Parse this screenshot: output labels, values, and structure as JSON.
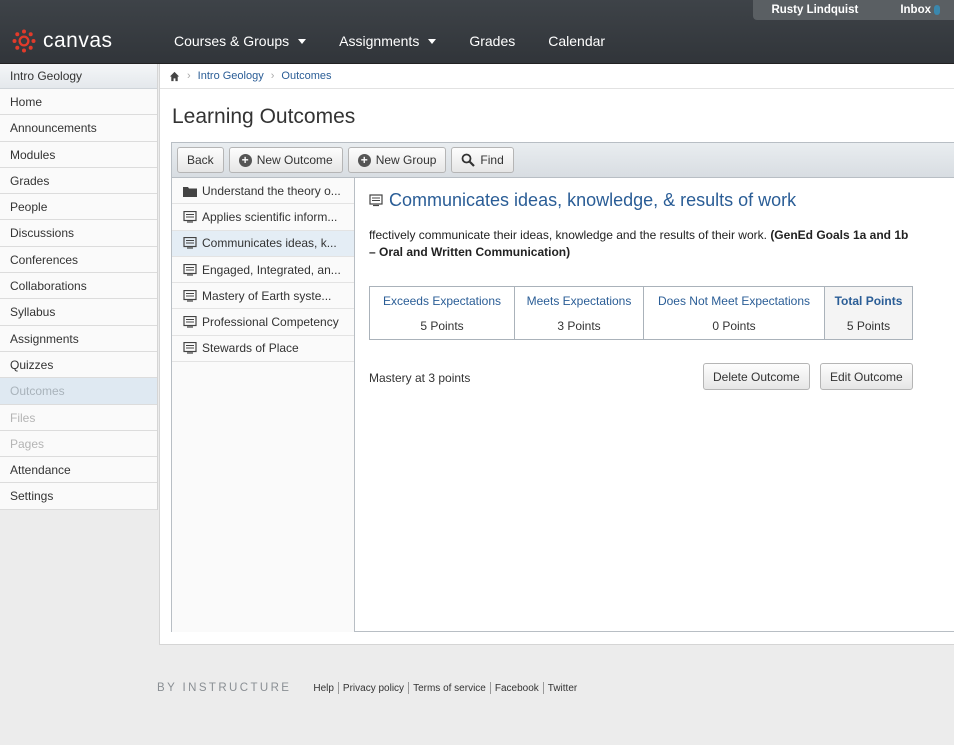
{
  "header": {
    "logo_text": "canvas",
    "user_name": "Rusty Lindquist",
    "inbox_label": "Inbox",
    "nav": [
      {
        "label": "Courses & Groups",
        "has_menu": true
      },
      {
        "label": "Assignments",
        "has_menu": true
      },
      {
        "label": "Grades",
        "has_menu": false
      },
      {
        "label": "Calendar",
        "has_menu": false
      }
    ]
  },
  "course_nav": {
    "title": "Intro Geology",
    "items": [
      {
        "label": "Home"
      },
      {
        "label": "Announcements"
      },
      {
        "label": "Modules"
      },
      {
        "label": "Grades"
      },
      {
        "label": "People"
      },
      {
        "label": "Discussions"
      },
      {
        "label": "Conferences"
      },
      {
        "label": "Collaborations"
      },
      {
        "label": "Syllabus"
      },
      {
        "label": "Assignments"
      },
      {
        "label": "Quizzes"
      },
      {
        "label": "Outcomes",
        "state": "active"
      },
      {
        "label": "Files",
        "state": "disabled"
      },
      {
        "label": "Pages",
        "state": "disabled"
      },
      {
        "label": "Attendance"
      },
      {
        "label": "Settings"
      }
    ]
  },
  "breadcrumb": {
    "course": "Intro Geology",
    "page": "Outcomes"
  },
  "page_title": "Learning Outcomes",
  "toolbar": {
    "back": "Back",
    "new_outcome": "New Outcome",
    "new_group": "New Group",
    "find": "Find"
  },
  "outcomes": [
    {
      "label": "Understand the theory o...",
      "type": "folder"
    },
    {
      "label": "Applies scientific inform...",
      "type": "outcome"
    },
    {
      "label": "Communicates ideas, k...",
      "type": "outcome",
      "selected": true
    },
    {
      "label": "Engaged, Integrated, an...",
      "type": "outcome"
    },
    {
      "label": "Mastery of Earth syste...",
      "type": "outcome"
    },
    {
      "label": "Professional Competency",
      "type": "outcome"
    },
    {
      "label": "Stewards of Place",
      "type": "outcome"
    }
  ],
  "detail": {
    "title": "Communicates ideas, knowledge, & results of work",
    "description": "ffectively communicate their ideas, knowledge and the results of their work. ",
    "description_bold": "(GenEd Goals 1a and 1b – Oral and Written Communication)",
    "rubric": [
      {
        "header": "Exceeds Expectations",
        "value": "5 Points"
      },
      {
        "header": "Meets Expectations",
        "value": "3 Points"
      },
      {
        "header": "Does Not Meet Expectations",
        "value": "0 Points"
      },
      {
        "header": "Total Points",
        "value": "5 Points"
      }
    ],
    "mastery": "Mastery at 3 points",
    "delete_label": "Delete Outcome",
    "edit_label": "Edit Outcome"
  },
  "footer": {
    "brand": "BY INSTRUCTURE",
    "links": [
      "Help",
      "Privacy policy",
      "Terms of service",
      "Facebook",
      "Twitter"
    ]
  },
  "colors": {
    "link": "#2a5d96",
    "logo_red": "#e13b2b",
    "header_bg": "#3a3e43"
  }
}
